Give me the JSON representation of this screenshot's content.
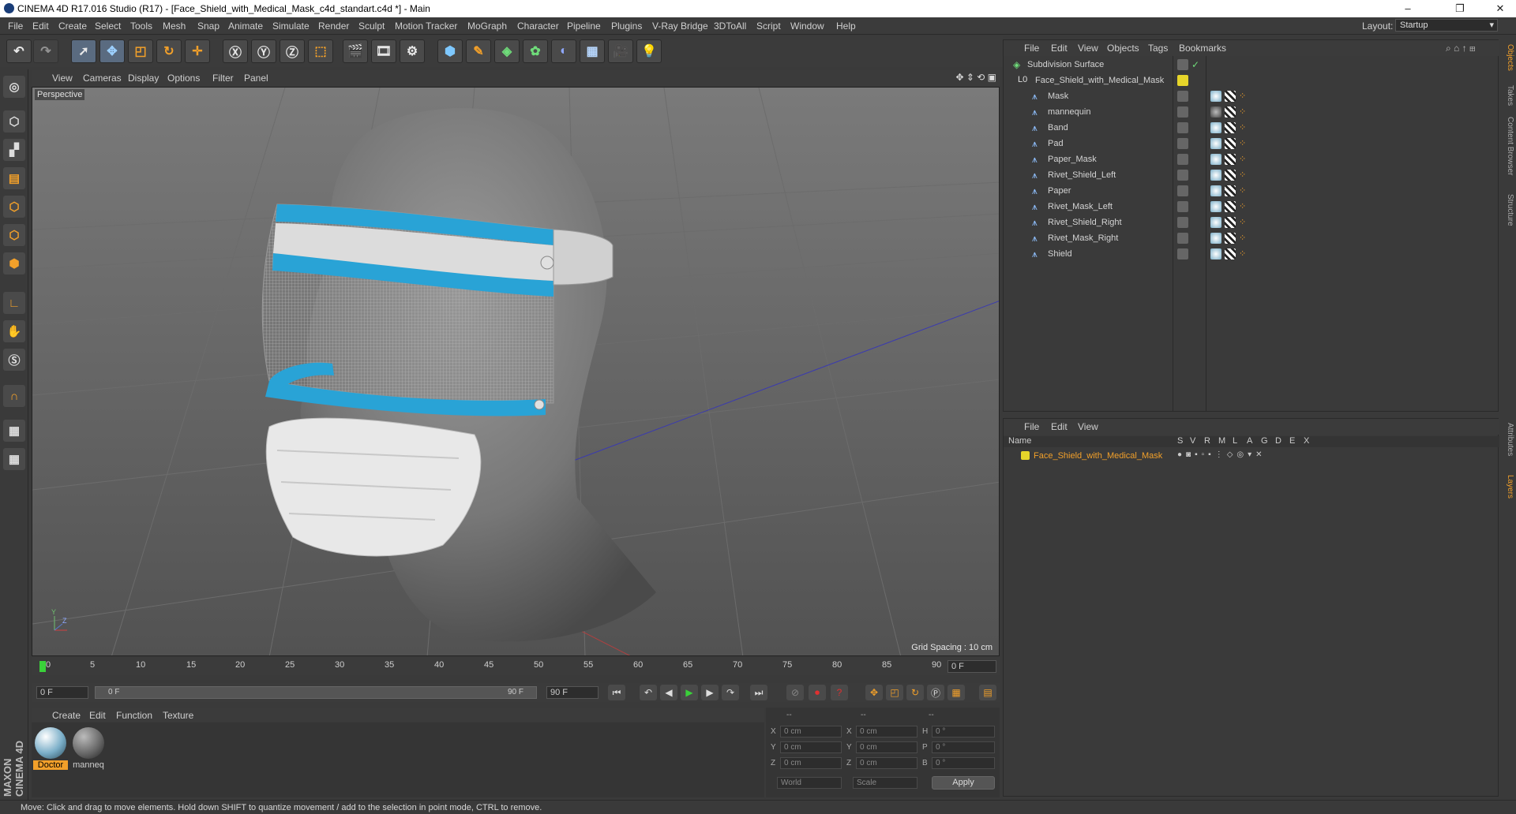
{
  "window": {
    "title": "CINEMA 4D R17.016 Studio (R17) - [Face_Shield_with_Medical_Mask_c4d_standart.c4d *] - Main"
  },
  "menu": [
    "File",
    "Edit",
    "Create",
    "Select",
    "Tools",
    "Mesh",
    "Snap",
    "Animate",
    "Simulate",
    "Render",
    "Sculpt",
    "Motion Tracker",
    "MoGraph",
    "Character",
    "Pipeline",
    "Plugins",
    "V-Ray Bridge",
    "3DToAll",
    "Script",
    "Window",
    "Help"
  ],
  "layout": {
    "label": "Layout:",
    "value": "Startup"
  },
  "viewport": {
    "menu": [
      "View",
      "Cameras",
      "Display",
      "Options",
      "Filter",
      "Panel"
    ],
    "label": "Perspective",
    "grid_spacing": "Grid Spacing : 10 cm"
  },
  "timeline": {
    "ticks": [
      "0",
      "5",
      "10",
      "15",
      "20",
      "25",
      "30",
      "35",
      "40",
      "45",
      "50",
      "55",
      "60",
      "65",
      "70",
      "75",
      "80",
      "85",
      "90"
    ],
    "current": "0 F",
    "start": "0 F",
    "range_start": "0 F",
    "range_end": "90 F",
    "end": "90 F"
  },
  "materials": {
    "menu": [
      "Create",
      "Edit",
      "Function",
      "Texture"
    ],
    "items": [
      {
        "label": "Doctor",
        "color": "#7aaec8",
        "selected": true
      },
      {
        "label": "manneq",
        "color": "#6a6a6a",
        "selected": false
      }
    ]
  },
  "coords": {
    "header": [
      "--",
      "--",
      "--"
    ],
    "rows": [
      {
        "a": "X",
        "av": "0 cm",
        "b": "X",
        "bv": "0 cm",
        "c": "H",
        "cv": "0 °"
      },
      {
        "a": "Y",
        "av": "0 cm",
        "b": "Y",
        "bv": "0 cm",
        "c": "P",
        "cv": "0 °"
      },
      {
        "a": "Z",
        "av": "0 cm",
        "b": "Z",
        "bv": "0 cm",
        "c": "B",
        "cv": "0 °"
      }
    ],
    "world": "World",
    "scale": "Scale",
    "apply": "Apply"
  },
  "objects": {
    "menu": [
      "File",
      "Edit",
      "View",
      "Objects",
      "Tags",
      "Bookmarks"
    ],
    "items": [
      "Subdivision Surface",
      "Face_Shield_with_Medical_Mask",
      "Mask",
      "mannequin",
      "Band",
      "Pad",
      "Paper_Mask",
      "Rivet_Shield_Left",
      "Paper",
      "Rivet_Mask_Left",
      "Rivet_Shield_Right",
      "Rivet_Mask_Right",
      "Shield"
    ]
  },
  "layers": {
    "menu": [
      "File",
      "Edit",
      "View"
    ],
    "columns": [
      "Name",
      "S",
      "V",
      "R",
      "M",
      "L",
      "A",
      "G",
      "D",
      "E",
      "X"
    ],
    "items": [
      "Face_Shield_with_Medical_Mask"
    ]
  },
  "side_tabs": [
    "Objects",
    "Takes",
    "Content Browser",
    "Structure",
    "Attributes",
    "Layers"
  ],
  "status": "Move: Click and drag to move elements. Hold down SHIFT to quantize movement / add to the selection in point mode, CTRL to remove.",
  "logo": "MAXON CINEMA 4D"
}
